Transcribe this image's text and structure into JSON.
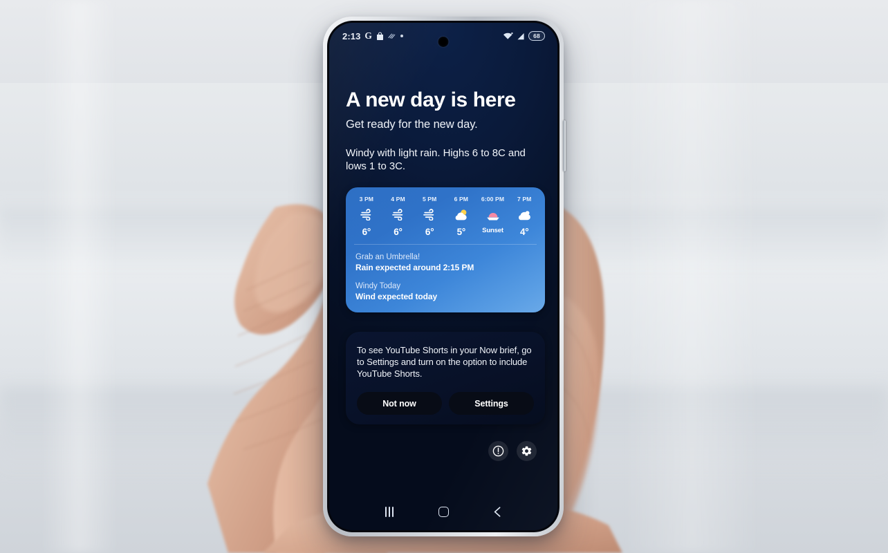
{
  "status_bar": {
    "clock": "2:13",
    "left_icons": [
      "google-g-icon",
      "shopping-bag-icon",
      "vibrate-icon",
      "dot-icon"
    ],
    "google_label": "G",
    "right_icons": [
      "wifi-icon",
      "signal-icon"
    ],
    "battery_level": "68"
  },
  "brief": {
    "headline": "A new day is here",
    "subhead": "Get ready for the new day.",
    "summary": "Windy with light rain. Highs 6 to 8C and lows 1 to 3C."
  },
  "weather": {
    "hourly": [
      {
        "time": "3 PM",
        "icon": "wind-icon",
        "temp": "6°",
        "is_word": false
      },
      {
        "time": "4 PM",
        "icon": "wind-icon",
        "temp": "6°",
        "is_word": false
      },
      {
        "time": "5 PM",
        "icon": "wind-icon",
        "temp": "6°",
        "is_word": false
      },
      {
        "time": "6 PM",
        "icon": "partly-cloudy-icon",
        "temp": "5°",
        "is_word": false
      },
      {
        "time": "6:00 PM",
        "icon": "sunset-icon",
        "temp": "Sunset",
        "is_word": true
      },
      {
        "time": "7 PM",
        "icon": "cloud-icon",
        "temp": "4°",
        "is_word": false
      }
    ],
    "alerts": [
      {
        "title": "Grab an Umbrella!",
        "description": "Rain expected around 2:15 PM"
      },
      {
        "title": "Windy Today",
        "description": "Wind expected today"
      }
    ]
  },
  "promo": {
    "text": "To see YouTube Shorts in your Now brief, go to Settings and turn on the option to include YouTube Shorts.",
    "dismiss_label": "Not now",
    "settings_label": "Settings"
  },
  "floating_actions": [
    {
      "icon": "info-circle-icon",
      "name": "info-button"
    },
    {
      "icon": "gear-icon",
      "name": "settings-button"
    }
  ],
  "nav_bar": {
    "recents_label": "Recents",
    "home_label": "Home",
    "back_label": "Back"
  },
  "colors": {
    "screen_bg": "#0a1a3a",
    "card_blue_top": "#2e6fc4",
    "card_blue_bottom": "#6aa9e8",
    "promo_bg": "#0a1530",
    "sunset_pink": "#f58aa5",
    "sun_yellow": "#ffd24d",
    "cloud_white": "#ffffff"
  }
}
